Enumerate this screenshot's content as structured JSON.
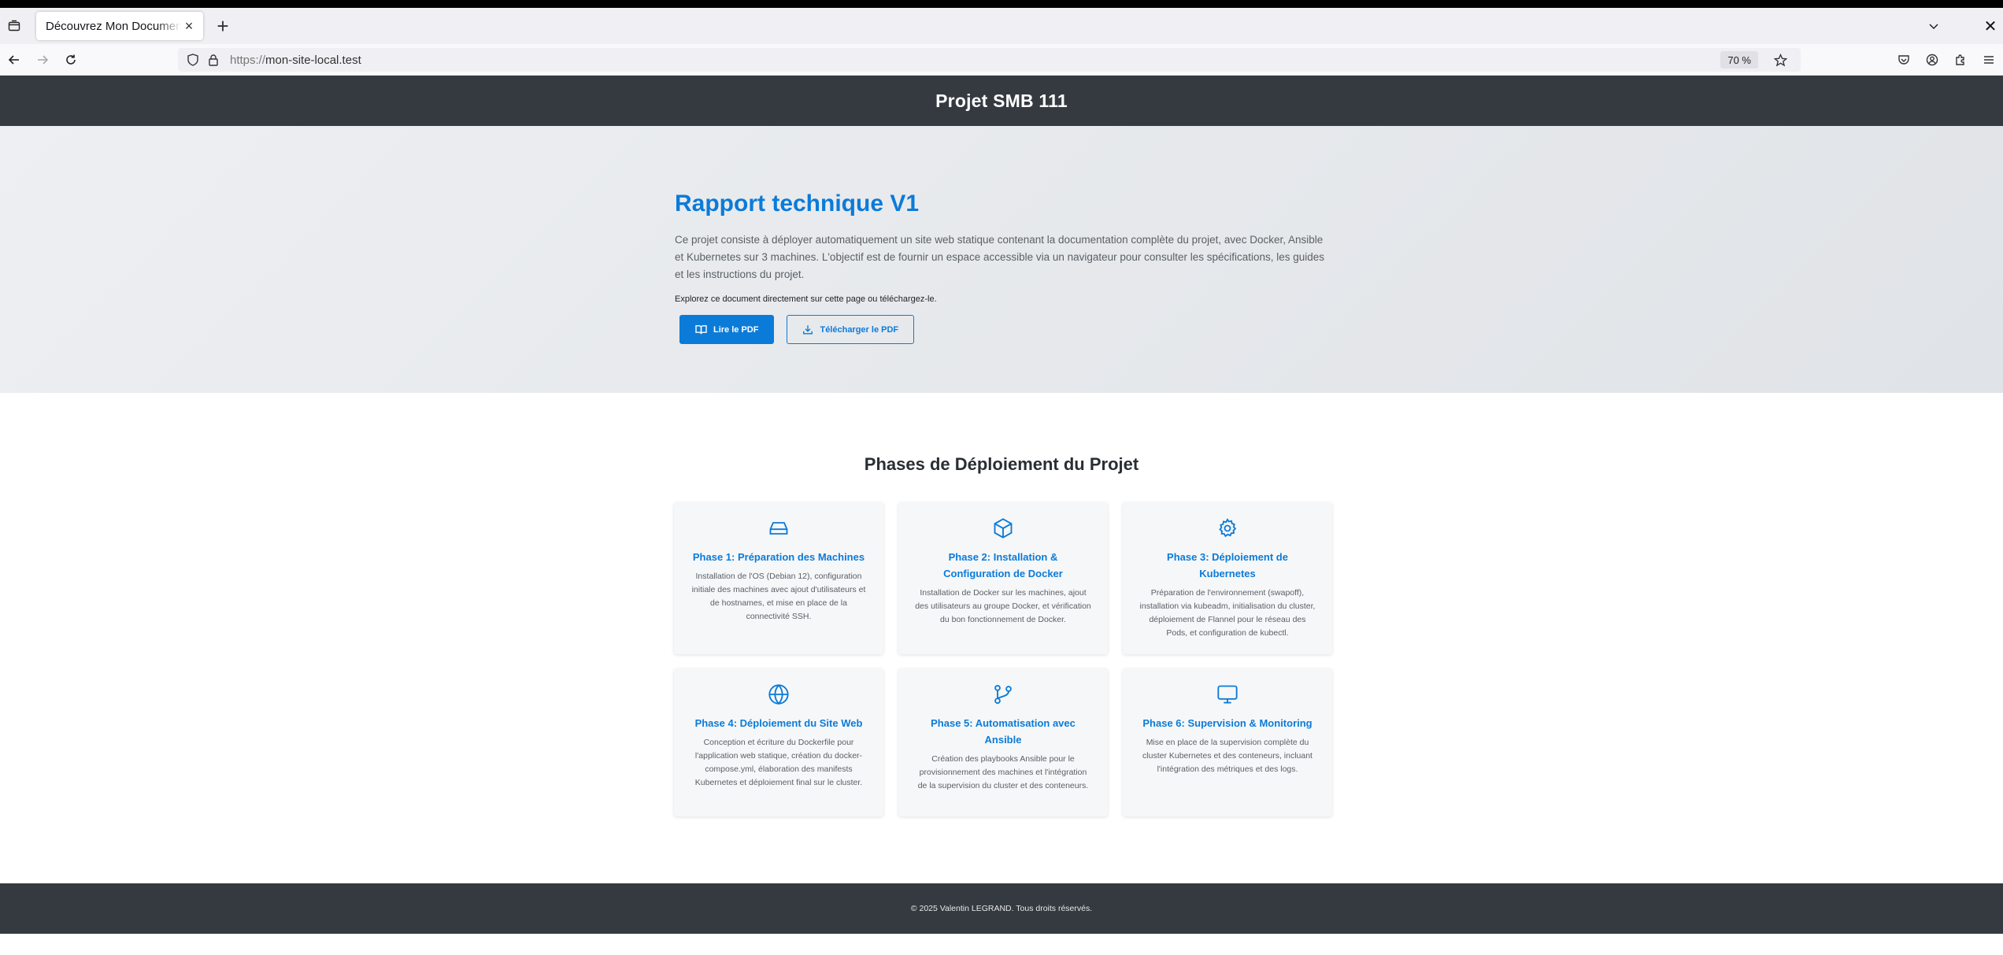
{
  "browser": {
    "tab_title": "Découvrez Mon Document PDF",
    "url_scheme": "https://",
    "url_host": "mon-site-local.test",
    "zoom": "70 %"
  },
  "site": {
    "header_title": "Projet SMB 111",
    "hero": {
      "title": "Rapport technique V1",
      "description": "Ce projet consiste à déployer automatiquement un site web statique contenant la documentation complète du projet, avec Docker, Ansible et Kubernetes sur 3 machines. L'objectif est de fournir un espace accessible via un navigateur pour consulter les spécifications, les guides et les instructions du projet.",
      "cta": "Explorez ce document directement sur cette page ou téléchargez-le.",
      "read_button": "Lire le PDF",
      "download_button": "Télécharger le PDF"
    },
    "phases_title": "Phases de Déploiement du Projet",
    "phases": [
      {
        "icon": "server-icon",
        "title": "Phase 1: Préparation des Machines",
        "text": "Installation de l'OS (Debian 12), configuration initiale des machines avec ajout d'utilisateurs et de hostnames, et mise en place de la connectivité SSH."
      },
      {
        "icon": "box-icon",
        "title": "Phase 2: Installation & Configuration de Docker",
        "text": "Installation de Docker sur les machines, ajout des utilisateurs au groupe Docker, et vérification du bon fonctionnement de Docker."
      },
      {
        "icon": "gear-icon",
        "title": "Phase 3: Déploiement de Kubernetes",
        "text": "Préparation de l'environnement (swapoff), installation via kubeadm, initialisation du cluster, déploiement de Flannel pour le réseau des Pods, et configuration de kubectl."
      },
      {
        "icon": "globe-icon",
        "title": "Phase 4: Déploiement du Site Web",
        "text": "Conception et écriture du Dockerfile pour l'application web statique, création du docker-compose.yml, élaboration des manifests Kubernetes et déploiement final sur le cluster."
      },
      {
        "icon": "git-branch-icon",
        "title": "Phase 5: Automatisation avec Ansible",
        "text": "Création des playbooks Ansible pour le provisionnement des machines et l'intégration de la supervision du cluster et des conteneurs."
      },
      {
        "icon": "monitor-icon",
        "title": "Phase 6: Supervision & Monitoring",
        "text": "Mise en place de la supervision complète du cluster Kubernetes et des conteneurs, incluant l'intégration des métriques et des logs."
      }
    ],
    "footer": "© 2025 Valentin LEGRAND. Tous droits réservés."
  },
  "colors": {
    "accent": "#0b7bd9",
    "header_bg": "#343a40"
  }
}
